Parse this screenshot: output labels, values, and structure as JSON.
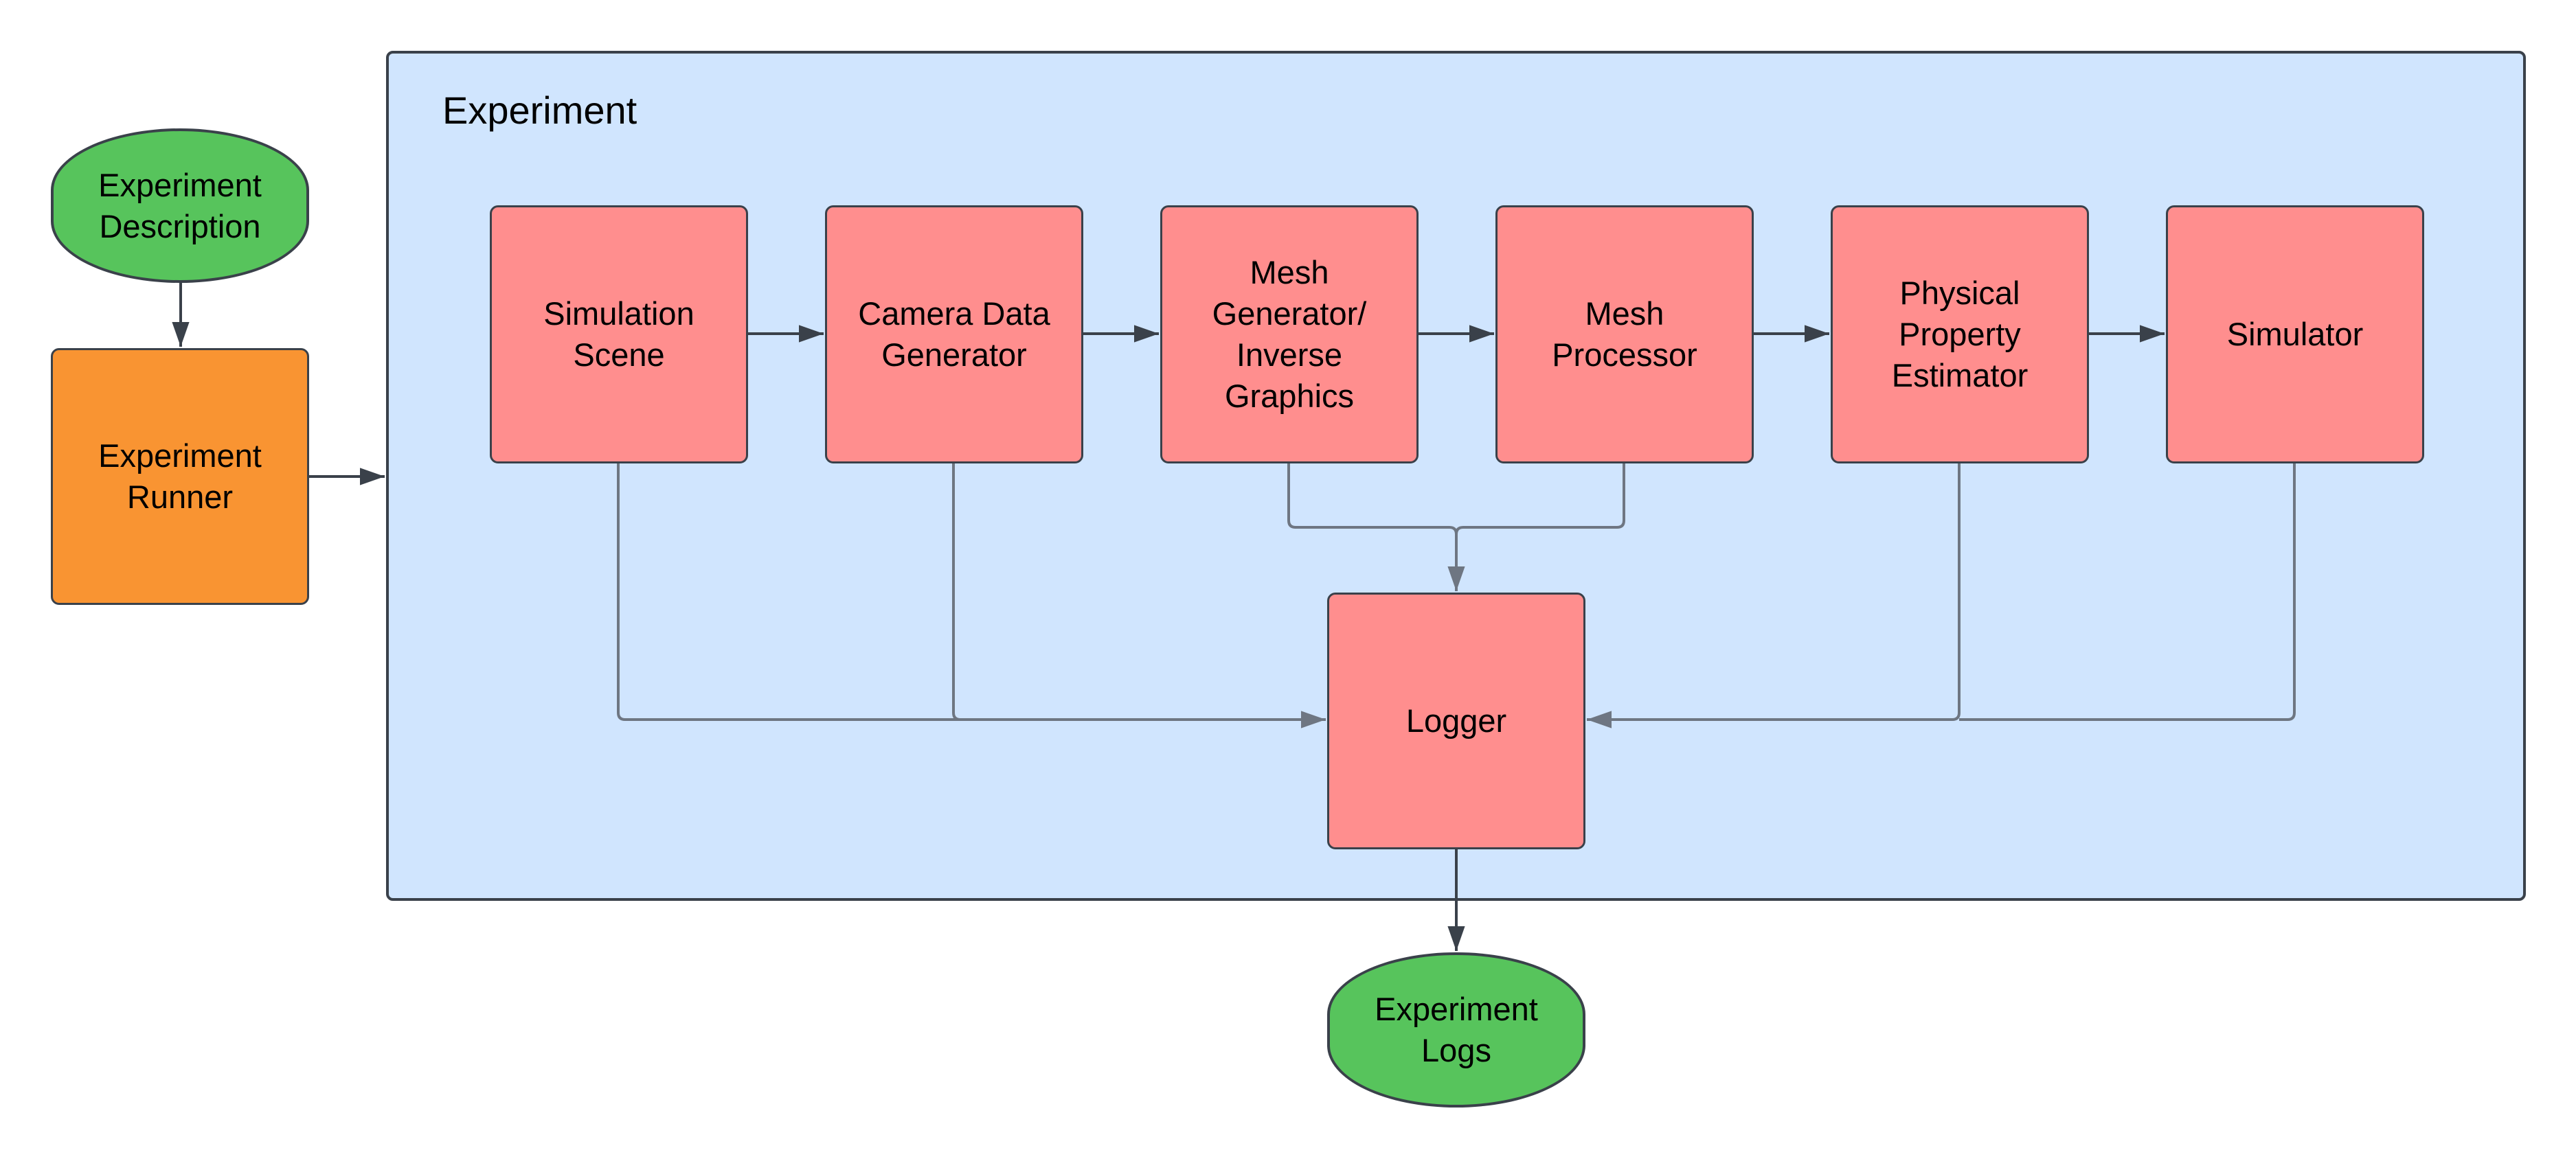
{
  "colors": {
    "terminal": "#57C45C",
    "runner": "#F99432",
    "process": "#FF8E8E",
    "group": "#D0E5FE",
    "stroke": "#3A414A",
    "connector": "#6E7682"
  },
  "group": {
    "title": "Experiment"
  },
  "nodes": {
    "description": "Experiment\nDescription",
    "runner": "Experiment\nRunner",
    "simulation_scene": "Simulation\nScene",
    "camera_data_generator": "Camera Data\nGenerator",
    "mesh_generator": "Mesh\nGenerator/\nInverse\nGraphics",
    "mesh_processor": "Mesh\nProcessor",
    "physical_property_estimator": "Physical\nProperty\nEstimator",
    "simulator": "Simulator",
    "logger": "Logger",
    "logs": "Experiment\nLogs"
  },
  "edges": [
    [
      "Experiment Description",
      "Experiment Runner"
    ],
    [
      "Experiment Runner",
      "Experiment"
    ],
    [
      "Simulation Scene",
      "Camera Data Generator"
    ],
    [
      "Camera Data Generator",
      "Mesh Generator/ Inverse Graphics"
    ],
    [
      "Mesh Generator/ Inverse Graphics",
      "Mesh Processor"
    ],
    [
      "Mesh Processor",
      "Physical Property Estimator"
    ],
    [
      "Physical Property Estimator",
      "Simulator"
    ],
    [
      "Simulation Scene",
      "Logger"
    ],
    [
      "Camera Data Generator",
      "Logger"
    ],
    [
      "Mesh Generator/ Inverse Graphics",
      "Logger"
    ],
    [
      "Mesh Processor",
      "Logger"
    ],
    [
      "Physical Property Estimator",
      "Logger"
    ],
    [
      "Simulator",
      "Logger"
    ],
    [
      "Logger",
      "Experiment Logs"
    ]
  ]
}
